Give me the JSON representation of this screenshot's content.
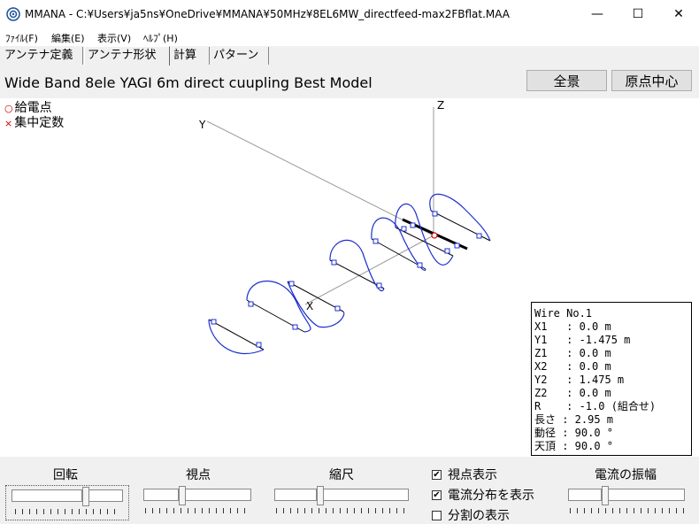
{
  "window": {
    "title": "MMANA - C:¥Users¥ja5ns¥OneDrive¥MMANA¥50MHz¥8EL6MW_directfeed-max2FBflat.MAA",
    "minimize": "—",
    "maximize": "☐",
    "close": "✕"
  },
  "menu": [
    "ﾌｧｲﾙ(F)",
    "編集(E)",
    "表示(V)",
    "ﾍﾙﾌﾟ(H)"
  ],
  "tabs": [
    "アンテナ定義",
    "アンテナ形状",
    "計算",
    "パターン"
  ],
  "active_tab": "アンテナ形状",
  "model_title": "Wide Band 8ele YAGI 6m direct cuupling Best Model",
  "buttons": {
    "full_view": "全景",
    "origin_center": "原点中心"
  },
  "legend": {
    "feed": "給電点",
    "load": "集中定数",
    "feed_marker": "○",
    "load_marker": "×"
  },
  "axes": {
    "y": "Y",
    "z": "Z",
    "x": "X"
  },
  "wire_info": [
    "Wire No.1",
    "X1   : 0.0 m",
    "Y1   : -1.475 m",
    "Z1   : 0.0 m",
    "X2   : 0.0 m",
    "Y2   : 1.475 m",
    "Z2   : 0.0 m",
    "R    : -1.0 (組合せ)",
    "長さ : 2.95 m",
    "動径 : 90.0 °",
    "天頂 : 90.0 °"
  ],
  "controls": {
    "rotate": "回転",
    "viewpoint": "視点",
    "scale": "縮尺",
    "current_amplitude": "電流の振幅"
  },
  "checkboxes": [
    {
      "label": "視点表示",
      "checked": true
    },
    {
      "label": "電流分布を表示",
      "checked": true
    },
    {
      "label": "分割の表示",
      "checked": false
    }
  ],
  "colors": {
    "current": "#1f2fd0",
    "marker": "#1f2fd0",
    "feed": "#d40000",
    "axis": "#9a9a9a"
  }
}
